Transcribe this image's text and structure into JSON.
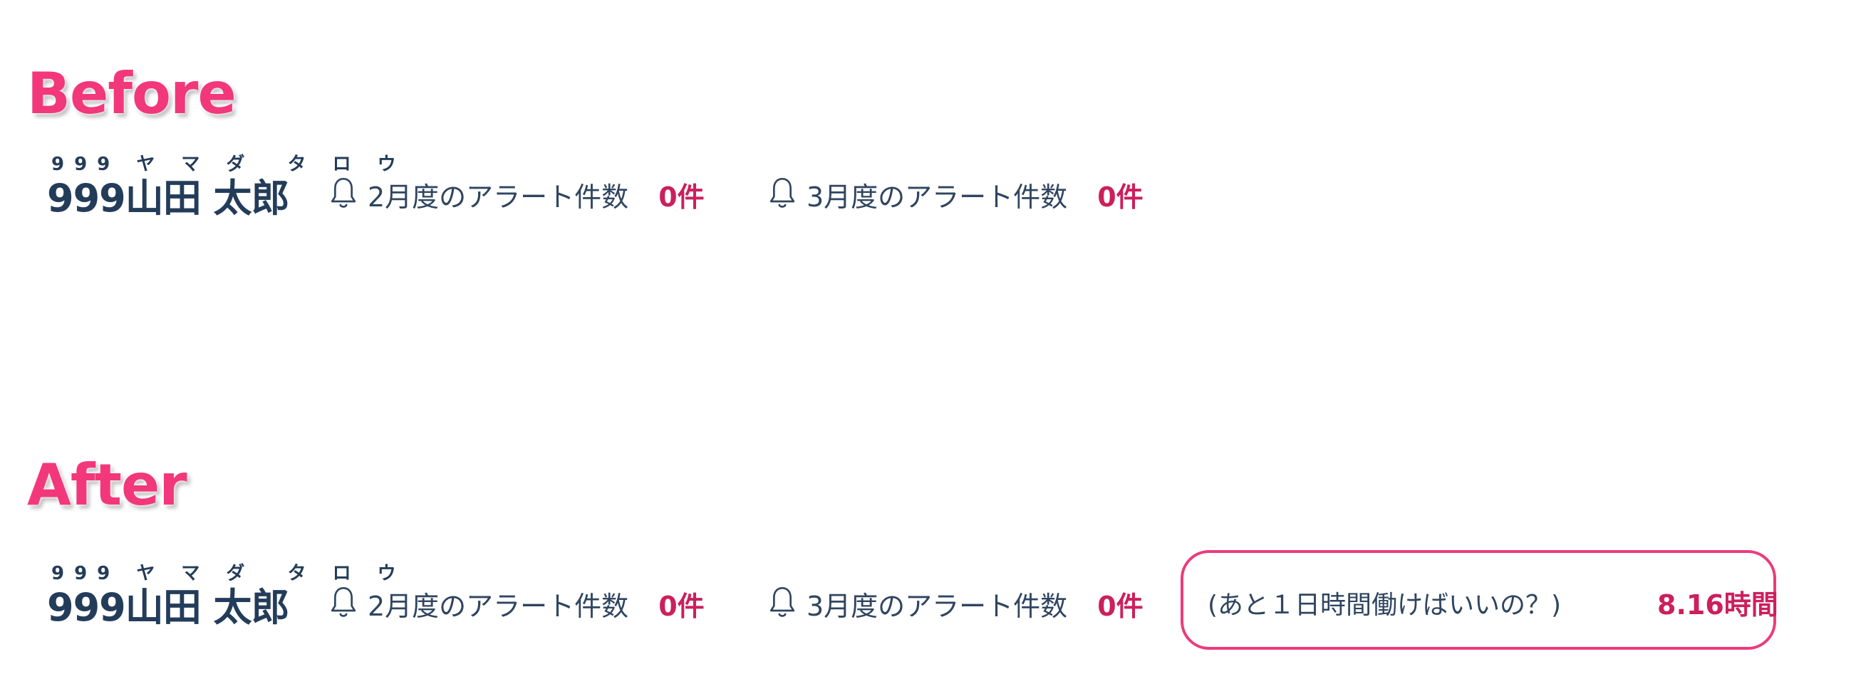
{
  "labels": {
    "before": "Before",
    "after": "After"
  },
  "before": {
    "user": {
      "ruby": "999 ヤ マ ダ  タ ロ ウ",
      "name": "999山田 太郎"
    },
    "alerts": [
      {
        "icon": "bell-icon",
        "label": "2月度のアラート件数",
        "count": "0件"
      },
      {
        "icon": "bell-icon",
        "label": "3月度のアラート件数",
        "count": "0件"
      }
    ]
  },
  "after": {
    "user": {
      "ruby": "999 ヤ マ ダ  タ ロ ウ",
      "name": "999山田 太郎"
    },
    "alerts": [
      {
        "icon": "bell-icon",
        "label": "2月度のアラート件数",
        "count": "0件"
      },
      {
        "icon": "bell-icon",
        "label": "3月度のアラート件数",
        "count": "0件"
      }
    ],
    "remaining": {
      "label": "(あと１日時間働けばいいの？)",
      "value": "8.16時間"
    }
  },
  "colors": {
    "accent": "#f2387a",
    "count": "#cc1f5c",
    "text": "#233c5a",
    "highlight_border": "#ed3a7b"
  }
}
